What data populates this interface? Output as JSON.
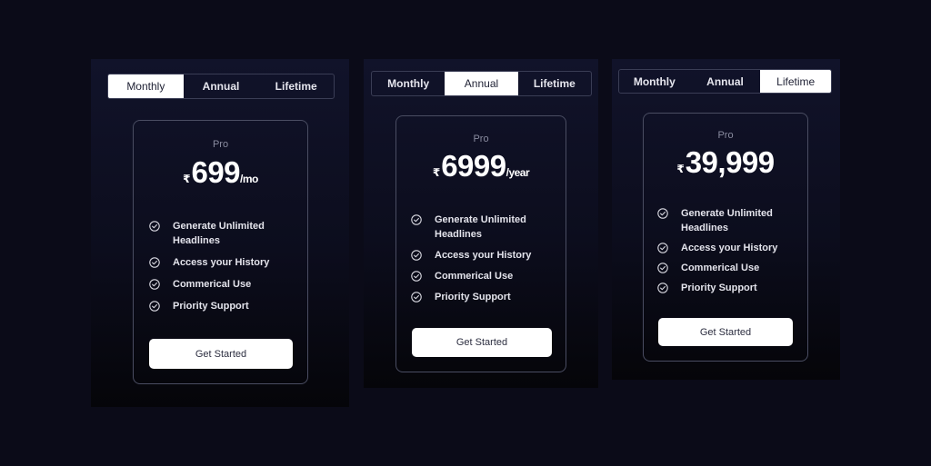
{
  "tabs": [
    "Monthly",
    "Annual",
    "Lifetime"
  ],
  "plans": [
    {
      "active_tab": "Monthly",
      "name": "Pro",
      "currency": "₹",
      "amount": "699",
      "period": "/mo",
      "features": [
        "Generate Unlimited Headlines",
        "Access your History",
        "Commerical Use",
        "Priority Support"
      ],
      "cta": "Get Started"
    },
    {
      "active_tab": "Annual",
      "name": "Pro",
      "currency": "₹",
      "amount": "6999",
      "period": "/year",
      "features": [
        "Generate Unlimited Headlines",
        "Access your History",
        "Commerical Use",
        "Priority Support"
      ],
      "cta": "Get Started"
    },
    {
      "active_tab": "Lifetime",
      "name": "Pro",
      "currency": "₹",
      "amount": "39,999",
      "period": "",
      "features": [
        "Generate Unlimited Headlines",
        "Access your History",
        "Commerical Use",
        "Priority Support"
      ],
      "cta": "Get Started"
    }
  ],
  "colors": {
    "page_background": "#0b0b18",
    "panel_top": "#11132a",
    "active_tab": "#ffffff",
    "card_border": "#4a4d62"
  },
  "icons": {
    "feature": "check-circle-icon"
  }
}
